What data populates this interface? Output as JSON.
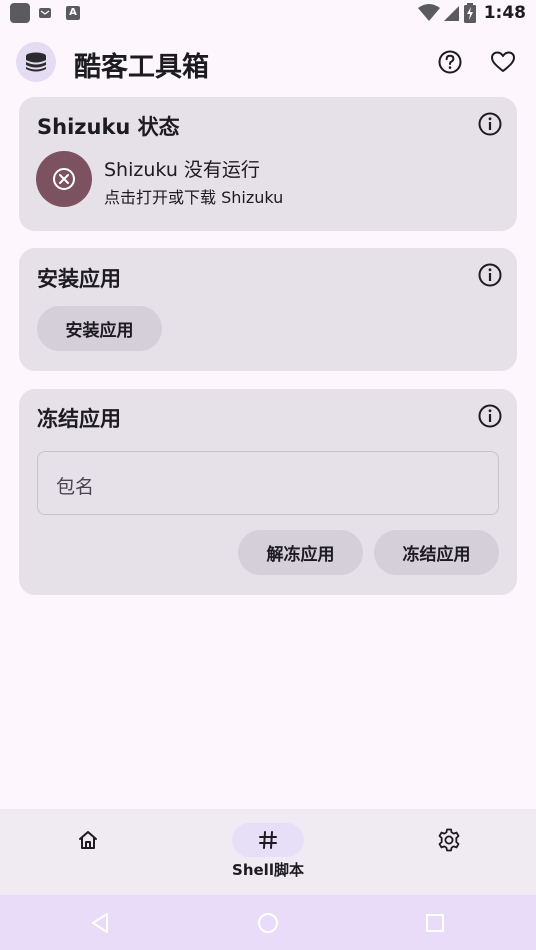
{
  "status_bar": {
    "time": "1:48",
    "icons": [
      "app-icon",
      "mail-icon",
      "a-icon",
      "wifi-icon",
      "signal-icon",
      "battery-icon"
    ]
  },
  "app_bar": {
    "title": "酷客工具箱",
    "logo_icon": "stack-icon",
    "actions": [
      "help-icon",
      "heart-icon"
    ]
  },
  "shizuku_card": {
    "title": "Shizuku 状态",
    "status_title": "Shizuku 没有运行",
    "status_subtitle": "点击打开或下载 Shizuku",
    "status_icon": "close-circle-icon",
    "status_color": "#7d5260"
  },
  "install_card": {
    "title": "安装应用",
    "button_label": "安装应用"
  },
  "freeze_card": {
    "title": "冻结应用",
    "input_placeholder": "包名",
    "unfreeze_label": "解冻应用",
    "freeze_label": "冻结应用"
  },
  "bottom_nav": {
    "items": [
      {
        "icon": "home-icon",
        "label": ""
      },
      {
        "icon": "hash-icon",
        "label": "Shell脚本",
        "active": true
      },
      {
        "icon": "gear-icon",
        "label": ""
      }
    ]
  },
  "colors": {
    "background": "#fdf7fd",
    "card": "#e6e0e9",
    "tonal_button": "#d5cfd9",
    "nav_active": "#e7def8"
  }
}
